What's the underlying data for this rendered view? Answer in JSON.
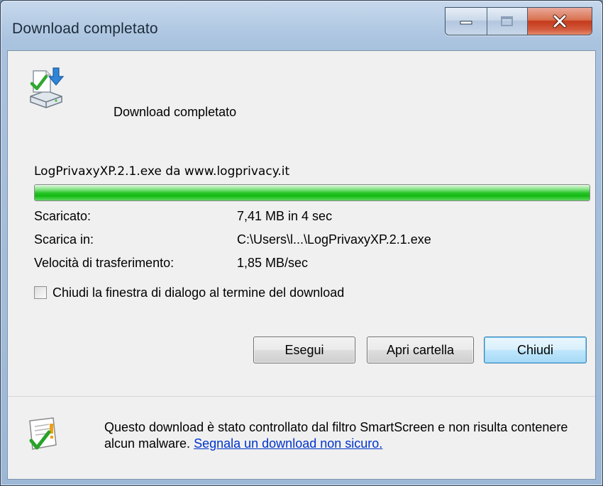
{
  "window": {
    "title": "Download completato",
    "caption_buttons": {
      "minimize": "minimize-icon",
      "maximize": "maximize-icon",
      "close": "close-icon"
    }
  },
  "header": {
    "icon": "download-complete-icon",
    "label": "Download completato"
  },
  "file": {
    "line": "LogPrivaxyXP.2.1.exe da www.logprivacy.it",
    "progress_percent": 100
  },
  "details": [
    {
      "label": "Scaricato:",
      "value": "7,41 MB in 4 sec"
    },
    {
      "label": "Scarica in:",
      "value": "C:\\Users\\l...\\LogPrivaxyXP.2.1.exe"
    },
    {
      "label": "Velocità di trasferimento:",
      "value": "1,85 MB/sec"
    }
  ],
  "close_when_done": {
    "label": "Chiudi la finestra di dialogo al termine del download",
    "checked": false
  },
  "buttons": {
    "run": "Esegui",
    "open_folder": "Apri cartella",
    "close": "Chiudi"
  },
  "footer": {
    "icon": "smartscreen-checked-icon",
    "text": "Questo download è stato controllato dal filtro SmartScreen e non risulta contenere alcun malware.",
    "link": "Segnala un download non sicuro."
  },
  "colors": {
    "progress": "#13b913",
    "link": "#0033cc",
    "close_button": "#c53a1c"
  }
}
